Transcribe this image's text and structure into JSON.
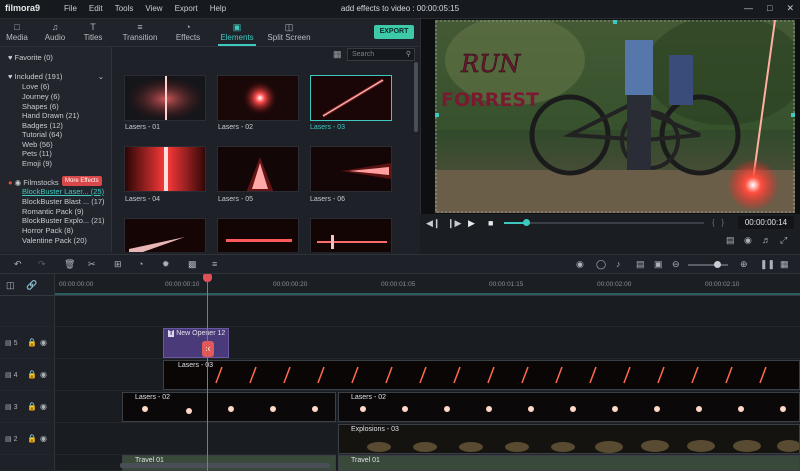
{
  "app": {
    "logo": "filmora9",
    "title": "add effects to video : 00:00:05:15"
  },
  "menu": [
    "File",
    "Edit",
    "Tools",
    "View",
    "Export",
    "Help"
  ],
  "tabs": [
    {
      "label": "Media",
      "icon": "folder-icon"
    },
    {
      "label": "Audio",
      "icon": "music-note-icon"
    },
    {
      "label": "Titles",
      "icon": "titles-icon"
    },
    {
      "label": "Transition",
      "icon": "transition-icon"
    },
    {
      "label": "Effects",
      "icon": "effects-icon"
    },
    {
      "label": "Elements",
      "icon": "elements-icon"
    },
    {
      "label": "Split Screen",
      "icon": "split-screen-icon"
    }
  ],
  "export_label": "EXPORT",
  "sidebar": {
    "favorite": "Favorite (0)",
    "included": "Included (191)",
    "included_items": [
      "Love (6)",
      "Journey (6)",
      "Shapes (6)",
      "Hand Drawn (21)",
      "Badges (12)",
      "Tutorial (64)",
      "Web (56)",
      "Pets (11)",
      "Emoji (9)"
    ],
    "filmstocks": "Filmstocks",
    "more_effects": "More Effects",
    "filmstock_items": [
      "BlockBuster Laser... (25)",
      "BlockBuster Blast ... (17)",
      "Romantic Pack (9)",
      "BlockBuster Explo... (21)",
      "Horror Pack (8)",
      "Valentine Pack (20)"
    ]
  },
  "search_placeholder": "Search",
  "elements": [
    "Lasers - 01",
    "Lasers - 02",
    "Lasers - 03",
    "Lasers - 04",
    "Lasers - 05",
    "Lasers - 06"
  ],
  "preview": {
    "text1": "RUN",
    "text2": "FORREST",
    "timecode": "00:00:00:14"
  },
  "ruler": [
    "00:00:00:00",
    "00:00:00:10",
    "00:00:00:20",
    "00:00:01:05",
    "00:00:01:15",
    "00:00:02:00",
    "00:00:02:10"
  ],
  "tracks": [
    {
      "num": "5",
      "clips": [
        {
          "label": "New Opener 12"
        }
      ]
    },
    {
      "num": "4",
      "clips": [
        {
          "label": "Lasers - 03"
        }
      ]
    },
    {
      "num": "3",
      "clips": [
        {
          "label": "Lasers - 02"
        },
        {
          "label": "Lasers - 02"
        }
      ]
    },
    {
      "num": "2",
      "clips": [
        {
          "label": "Explosions - 03"
        }
      ]
    },
    {
      "num": "",
      "clips": [
        {
          "label": "Travel 01"
        },
        {
          "label": "Travel 01"
        }
      ]
    }
  ],
  "colors": {
    "accent": "#3ec9c0",
    "laser": "#ff3a3a",
    "playhead": "#e0505a"
  }
}
